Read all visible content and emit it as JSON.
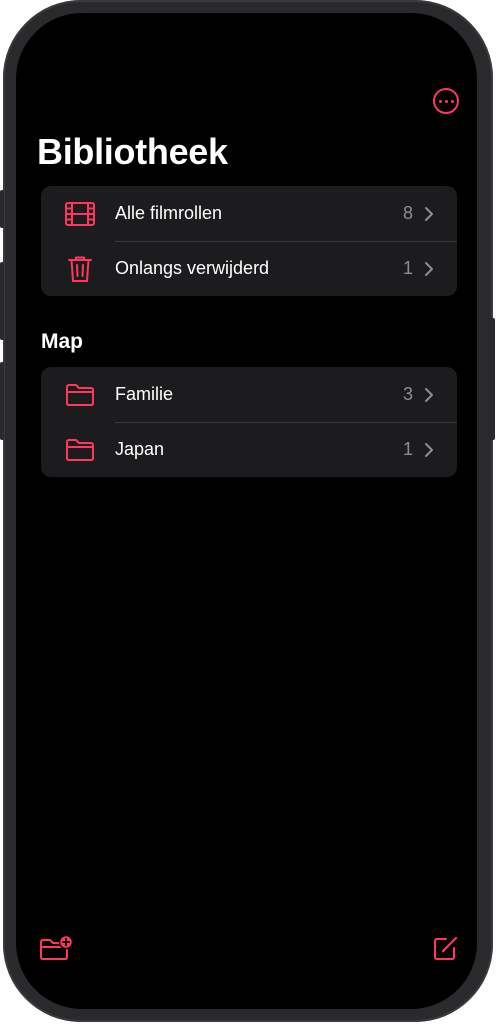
{
  "header": {
    "more_icon": "ellipsis-circle-icon",
    "title": "Bibliotheek"
  },
  "library": {
    "items": [
      {
        "label": "Alle filmrollen",
        "count": "8",
        "icon": "film-icon"
      },
      {
        "label": "Onlangs verwijderd",
        "count": "1",
        "icon": "trash-icon"
      }
    ]
  },
  "folders": {
    "header": "Map",
    "items": [
      {
        "label": "Familie",
        "count": "3",
        "icon": "folder-icon"
      },
      {
        "label": "Japan",
        "count": "1",
        "icon": "folder-icon"
      }
    ]
  },
  "toolbar": {
    "left_icon": "new-folder-icon",
    "right_icon": "compose-icon"
  },
  "colors": {
    "accent": "#ff375f",
    "background": "#000000",
    "cell": "#1c1c1e",
    "separator": "#38383a",
    "secondary_text": "#8e8e93"
  }
}
